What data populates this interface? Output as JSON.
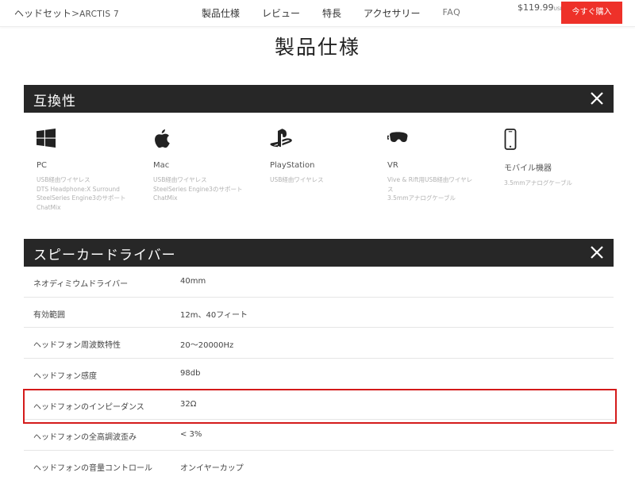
{
  "nav": {
    "breadcrumb_category": "ヘッドセット",
    "breadcrumb_sep": ">",
    "breadcrumb_product": "ARCTIS 7",
    "links": [
      "製品仕様",
      "レビュー",
      "特長",
      "アクセサリー",
      "FAQ"
    ],
    "price": "$119.99",
    "currency": "USD",
    "buy_label": "今すぐ購入"
  },
  "page_title": "製品仕様",
  "compat": {
    "title": "互換性",
    "platforms": [
      {
        "icon": "windows-icon",
        "name": "PC",
        "features": [
          "USB経由ワイヤレス",
          "DTS Headphone:X Surround",
          "SteelSeries Engine3のサポート",
          "ChatMix"
        ]
      },
      {
        "icon": "apple-icon",
        "name": "Mac",
        "features": [
          "USB経由ワイヤレス",
          "SteelSeries Engine3のサポート",
          "ChatMix"
        ]
      },
      {
        "icon": "playstation-icon",
        "name": "PlayStation",
        "features": [
          "USB経由ワイヤレス"
        ]
      },
      {
        "icon": "vr-headset-icon",
        "name": "VR",
        "features": [
          "Vive & Rift用USB経由ワイヤレ",
          "ス",
          "3.5mmアナログケーブル"
        ]
      },
      {
        "icon": "mobile-phone-icon",
        "name": "モバイル機器",
        "features": [
          "3.5mmアナログケーブル"
        ]
      }
    ]
  },
  "speaker": {
    "title": "スピーカードライバー",
    "rows": [
      {
        "label": "ネオディミウムドライバー",
        "value": "40mm"
      },
      {
        "label": "有効範囲",
        "value": "12m、40フィート"
      },
      {
        "label": "ヘッドフォン周波数特性",
        "value": "20〜20000Hz"
      },
      {
        "label": "ヘッドフォン感度",
        "value": "98db"
      },
      {
        "label": "ヘッドフォンのインピーダンス",
        "value": "32Ω"
      },
      {
        "label": "ヘッドフォンの全高調波歪み",
        "value": "< 3%"
      },
      {
        "label": "ヘッドフォンの音量コントロール",
        "value": "オンイヤーカップ"
      }
    ]
  },
  "colors": {
    "accent": "#ee3129",
    "bar": "#272727",
    "highlight": "#d41b1b"
  }
}
